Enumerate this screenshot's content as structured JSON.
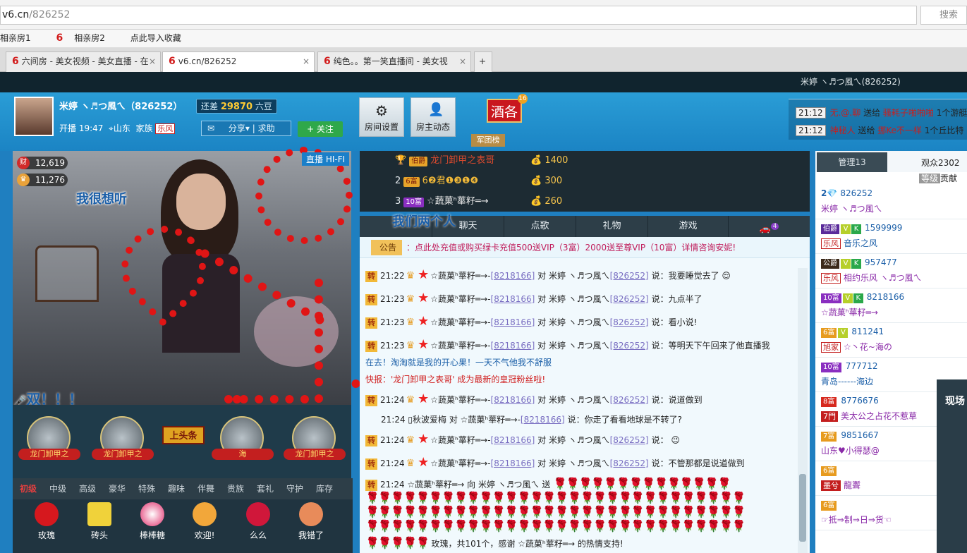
{
  "browser": {
    "url_host": "v6.cn",
    "url_path": "/826252",
    "search_placeholder": "搜索",
    "bookmarks": [
      "相亲房1",
      "相亲房2",
      "点此导入收藏"
    ],
    "tabs": [
      {
        "label": "六间房 - 美女视频 - 美女直播 - 在"
      },
      {
        "label": "v6.cn/826252"
      },
      {
        "label": "纯色。。第一笑直播间 - 美女视"
      }
    ]
  },
  "topbar": {
    "user": "米婷 ヽ♬つ風ㄟ(826252)"
  },
  "header": {
    "name": "米婷 ヽ♬つ風ㄟ（826252）",
    "diff_prefix": "还差",
    "diff_value": "29870",
    "diff_suffix": "六豆",
    "open_label": "开播 19:47",
    "location": "山东",
    "family_label": "家族",
    "family": "乐风",
    "share": "分享",
    "help": "求助",
    "follow": "+ 关注",
    "room_settings": "房间设置",
    "host_news": "房主动态",
    "jiu": "酒各",
    "jiu_badge": "16",
    "jtb": "军团榜"
  },
  "ticker": [
    {
      "time": "21:12",
      "from": "无.@.聊",
      "action": "送给",
      "to": "骚耗子啪啪啪",
      "gift": "1个游艇"
    },
    {
      "time": "21:12",
      "from": "神秘人",
      "action": "送给",
      "to": "挪Ke不一样",
      "gift": "1个丘比特"
    }
  ],
  "video": {
    "count1": "12,619",
    "count2": "11,276",
    "badge1": "财",
    "overlay_text": "我很想听",
    "live_tag": "直播",
    "hd_tag": "HI-FI",
    "caption": "双！！！"
  },
  "guards": [
    {
      "label": "龙门卸甲之"
    },
    {
      "label": "龙门卸甲之"
    },
    {
      "label": "海"
    },
    {
      "label": "龙门卸甲之"
    }
  ],
  "toutiao": "上头条",
  "gift_tabs": [
    "初级",
    "中级",
    "高级",
    "豪华",
    "特殊",
    "趣味",
    "伴舞",
    "贵族",
    "套礼",
    "守护",
    "库存"
  ],
  "gifts": [
    "玫瑰",
    "砖头",
    "棒棒糖",
    "欢迎!",
    "么么",
    "我错了"
  ],
  "rank": [
    {
      "no": "1",
      "level": "伯爵",
      "name": "龙门卸甲之表哥",
      "value": "1400"
    },
    {
      "no": "2",
      "level": "6富",
      "name": "6❷君❶❸❶❹",
      "value": "300"
    },
    {
      "no": "3",
      "level": "10富",
      "name": "☆蔬菓ʰ蕐籽═→",
      "value": "260"
    }
  ],
  "overlay_title": "我们两个人",
  "chat_tabs": [
    "聊天",
    "点歌",
    "礼物",
    "游戏"
  ],
  "chat_tab_badge": "4",
  "notice": {
    "label": "公告",
    "text": "：点此处充值或购买绿卡充值500送VIP（3富）2000送至尊VIP（10富）详情咨询安妮!"
  },
  "chat": [
    {
      "tag": "转",
      "time": "21:22",
      "user": "☆蔬菓ʰ蕐籽═→",
      "uid": "[8218166]",
      "to": "对 米婷 ヽ♬つ風ㄟ",
      "toid": "[826252]",
      "say": "说：我要睡觉去了"
    },
    {
      "tag": "转",
      "time": "21:23",
      "user": "☆蔬菓ʰ蕐籽═→",
      "uid": "[8218166]",
      "to": "对 米婷 ヽ♬つ風ㄟ",
      "toid": "[826252]",
      "say": "说：九点半了"
    },
    {
      "tag": "转",
      "time": "21:23",
      "user": "☆蔬菓ʰ蕐籽═→",
      "uid": "[8218166]",
      "to": "对 米婷 ヽ♬つ風ㄟ",
      "toid": "[826252]",
      "say": "说：看小说!"
    },
    {
      "tag": "转",
      "time": "21:23",
      "user": "☆蔬菓ʰ蕐籽═→",
      "uid": "[8218166]",
      "to": "对 米婷 ヽ♬つ風ㄟ",
      "toid": "[826252]",
      "say": "说：等明天下午回来了他直播我"
    }
  ],
  "chat_cont": "在去！淘淘就是我的开心果！一天不气他我不舒服",
  "chat_flash": "快报：'龙门卸甲之表哥' 成为最新的皇冠粉丝啦!",
  "chat2": [
    {
      "tag": "转",
      "time": "21:24",
      "user": "☆蔬菓ʰ蕐籽═→",
      "uid": "[8218166]",
      "to": "对 米婷 ヽ♬つ風ㄟ",
      "toid": "[826252]",
      "say": "说：说道做到"
    }
  ],
  "chat3": {
    "time": "21:24",
    "user": "秋波爱梅",
    "to": "对 ☆蔬菓ʰ蕐籽═→",
    "toid": "[8218166]",
    "say": "说：你走了看看地球是不转了?"
  },
  "chat4": [
    {
      "tag": "转",
      "time": "21:24",
      "user": "☆蔬菓ʰ蕐籽═→",
      "uid": "[8218166]",
      "to": "对 米婷 ヽ♬つ風ㄟ",
      "toid": "[826252]",
      "say": "说："
    },
    {
      "tag": "转",
      "time": "21:24",
      "user": "☆蔬菓ʰ蕐籽═→",
      "uid": "[8218166]",
      "to": "对 米婷 ヽ♬つ風ㄟ",
      "toid": "[826252]",
      "say": "说：不管那都是说道做到"
    }
  ],
  "gift_msg": {
    "tag": "转",
    "time": "21:24",
    "text": "☆蔬菓ʰ蕐籽═→ 向 米婷 ヽ♬つ風ㄟ 送",
    "thanks": "玫瑰，共101个，感谢 ☆蔬菓ʰ蕐籽═→ 的热情支持!"
  },
  "right": {
    "manage": "管理13",
    "audience": "观众2302",
    "level_h": "等级",
    "contrib_h": "贡献",
    "users": [
      {
        "lv": "2",
        "id": "826252",
        "name": "米婷 ヽ♬つ風ㄟ",
        "fam": ""
      },
      {
        "lv": "伯爵",
        "id": "1599999",
        "name": "音乐之风",
        "fam": "乐风"
      },
      {
        "lv": "公爵",
        "id": "957477",
        "name": "相约乐风 ヽ♬つ風ㄟ",
        "fam": "乐风"
      },
      {
        "lv": "10富",
        "id": "8218166",
        "name": "☆蔬菓ʰ蕐籽═→",
        "fam": ""
      },
      {
        "lv": "6富",
        "id": "811241",
        "name": "☆丶花~海の",
        "fam": "旭家"
      },
      {
        "lv": "10富",
        "id": "777712",
        "name": "青岛------海边",
        "fam": ""
      },
      {
        "lv": "8富",
        "id": "8776676",
        "name": "美太公之占花不惹草",
        "fam": "7門"
      },
      {
        "lv": "7富",
        "id": "9851667",
        "name": "山东♥小得瑟@",
        "fam": ""
      },
      {
        "lv": "6富",
        "id": "",
        "name": "龍聻",
        "fam": "墨兮"
      },
      {
        "lv": "6富",
        "id": "",
        "name": "☞抵⇒制⇒日⇒货☜",
        "fam": ""
      }
    ],
    "side_tab": "现场"
  }
}
